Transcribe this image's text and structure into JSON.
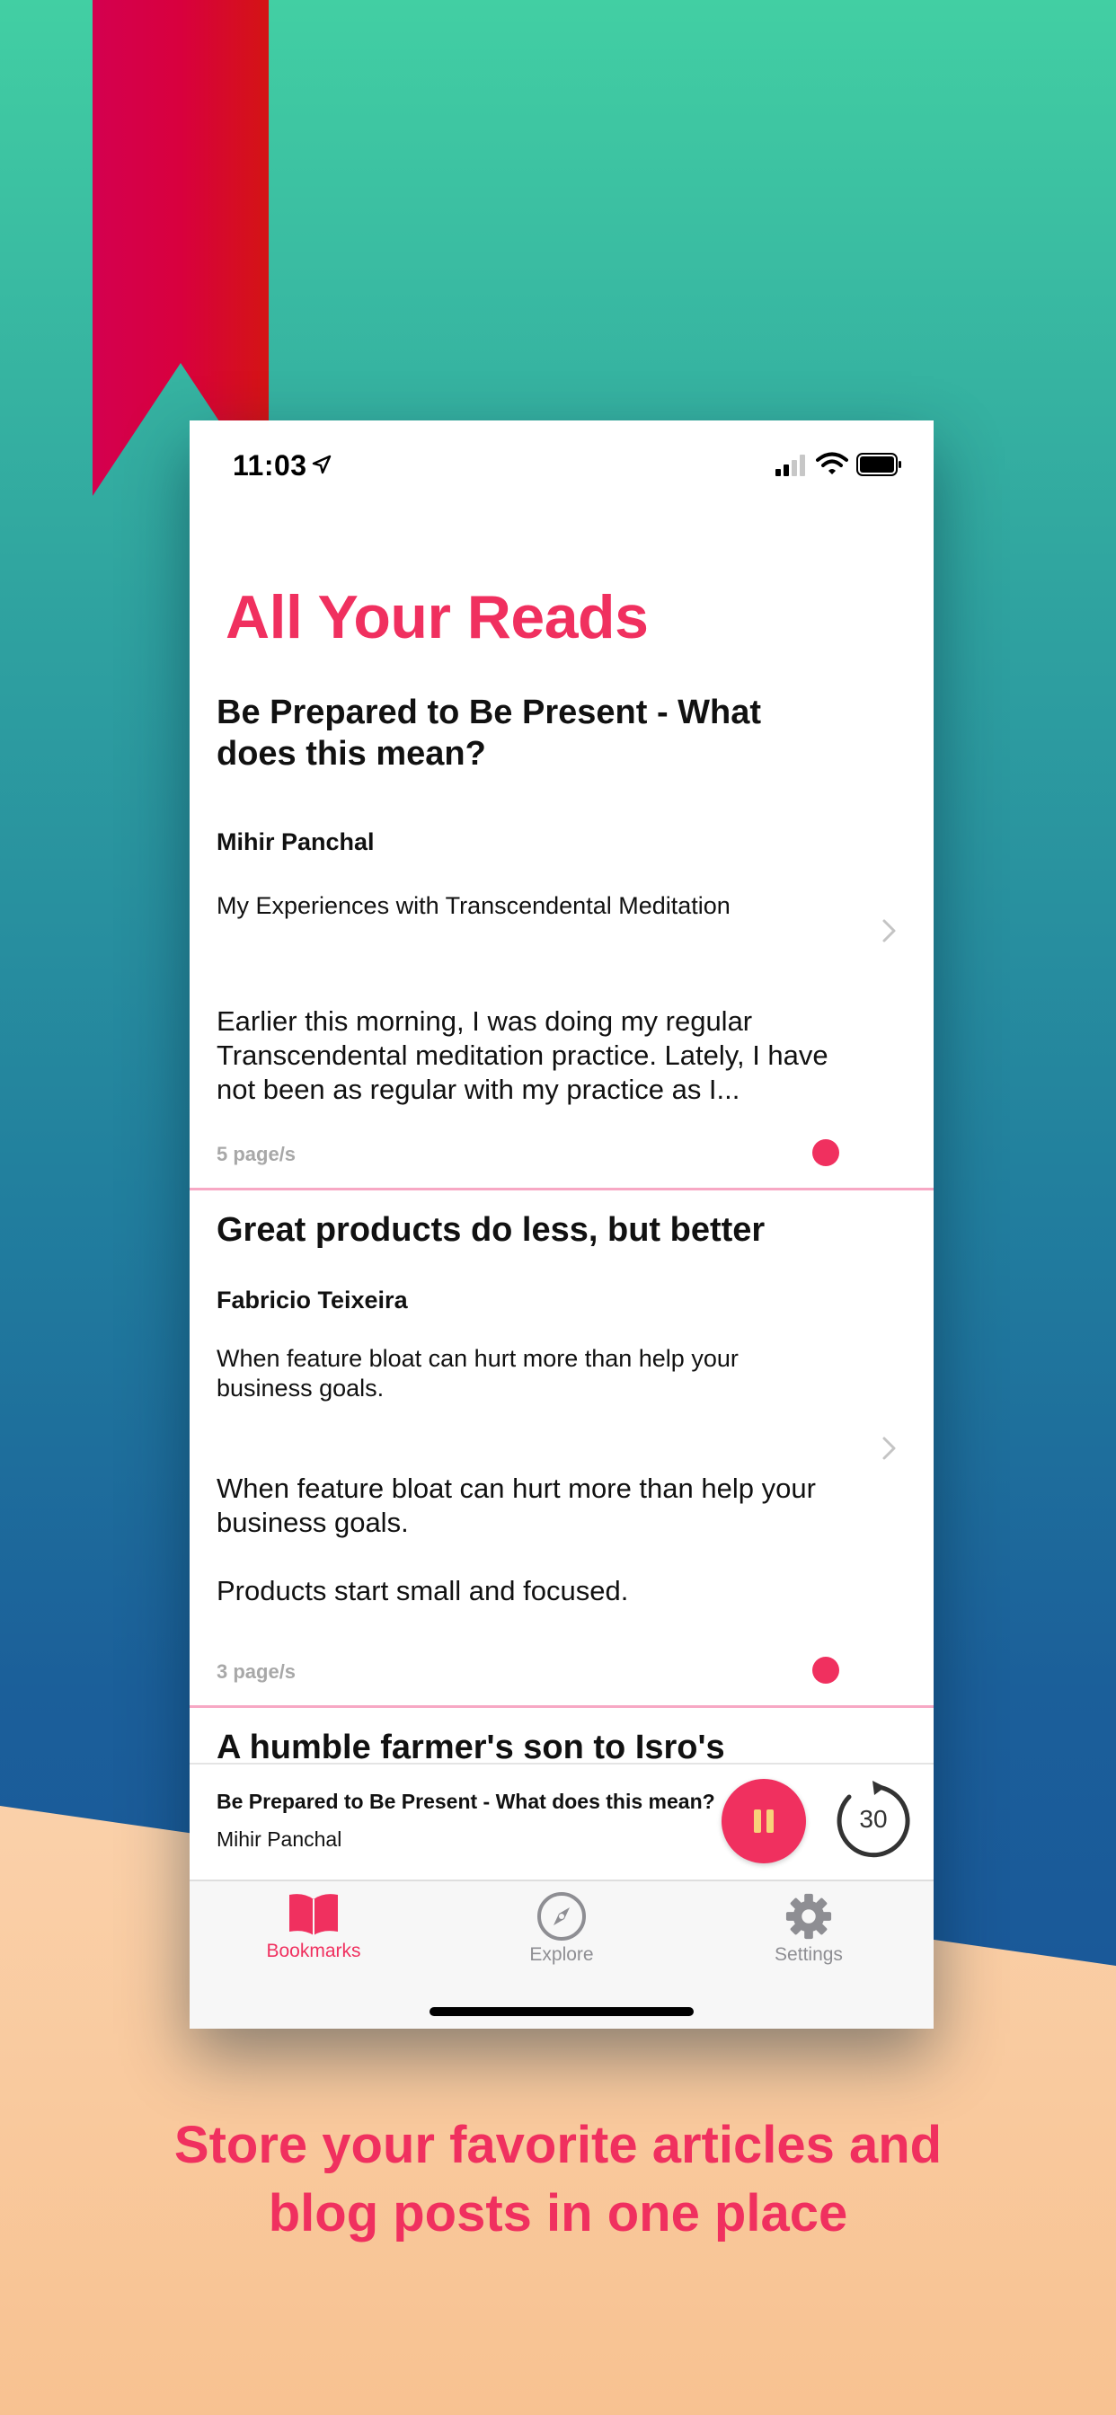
{
  "status_bar": {
    "time": "11:03"
  },
  "header": {
    "title": "All Your Reads"
  },
  "articles": [
    {
      "title": "Be Prepared to Be Present - What does this mean?",
      "author": "Mihir Panchal",
      "subtitle": "My Experiences with Transcendental Meditation",
      "excerpt": "Earlier this morning, I was doing my regular Transcendental meditation practice. Lately, I have not been as regular with my practice as I...",
      "pages": "5 page/s",
      "unread": true
    },
    {
      "title": "Great products do less, but better",
      "author": "Fabricio Teixeira",
      "subtitle": "When feature bloat can hurt more than help your business goals.",
      "excerpt_lines": [
        "When feature bloat can hurt more than help your business goals.",
        "Products start small and focused."
      ],
      "pages": "3 page/s",
      "unread": true
    },
    {
      "title": "A humble farmer's son to Isro's"
    }
  ],
  "player": {
    "title": "Be Prepared to Be Present - What does this mean?",
    "author": "Mihir Panchal",
    "skip_seconds": "30",
    "state": "playing"
  },
  "tab_bar": {
    "tabs": [
      {
        "label": "Bookmarks",
        "icon": "book-icon",
        "active": true
      },
      {
        "label": "Explore",
        "icon": "compass-icon",
        "active": false
      },
      {
        "label": "Settings",
        "icon": "gear-icon",
        "active": false
      }
    ]
  },
  "caption": {
    "line1": "Store your favorite articles and",
    "line2": "blog posts in one place"
  },
  "colors": {
    "accent": "#f0305f",
    "ribbon": "#d8003e",
    "inactive_tab": "#8e8e93",
    "pages_text": "#a8a8a8"
  }
}
